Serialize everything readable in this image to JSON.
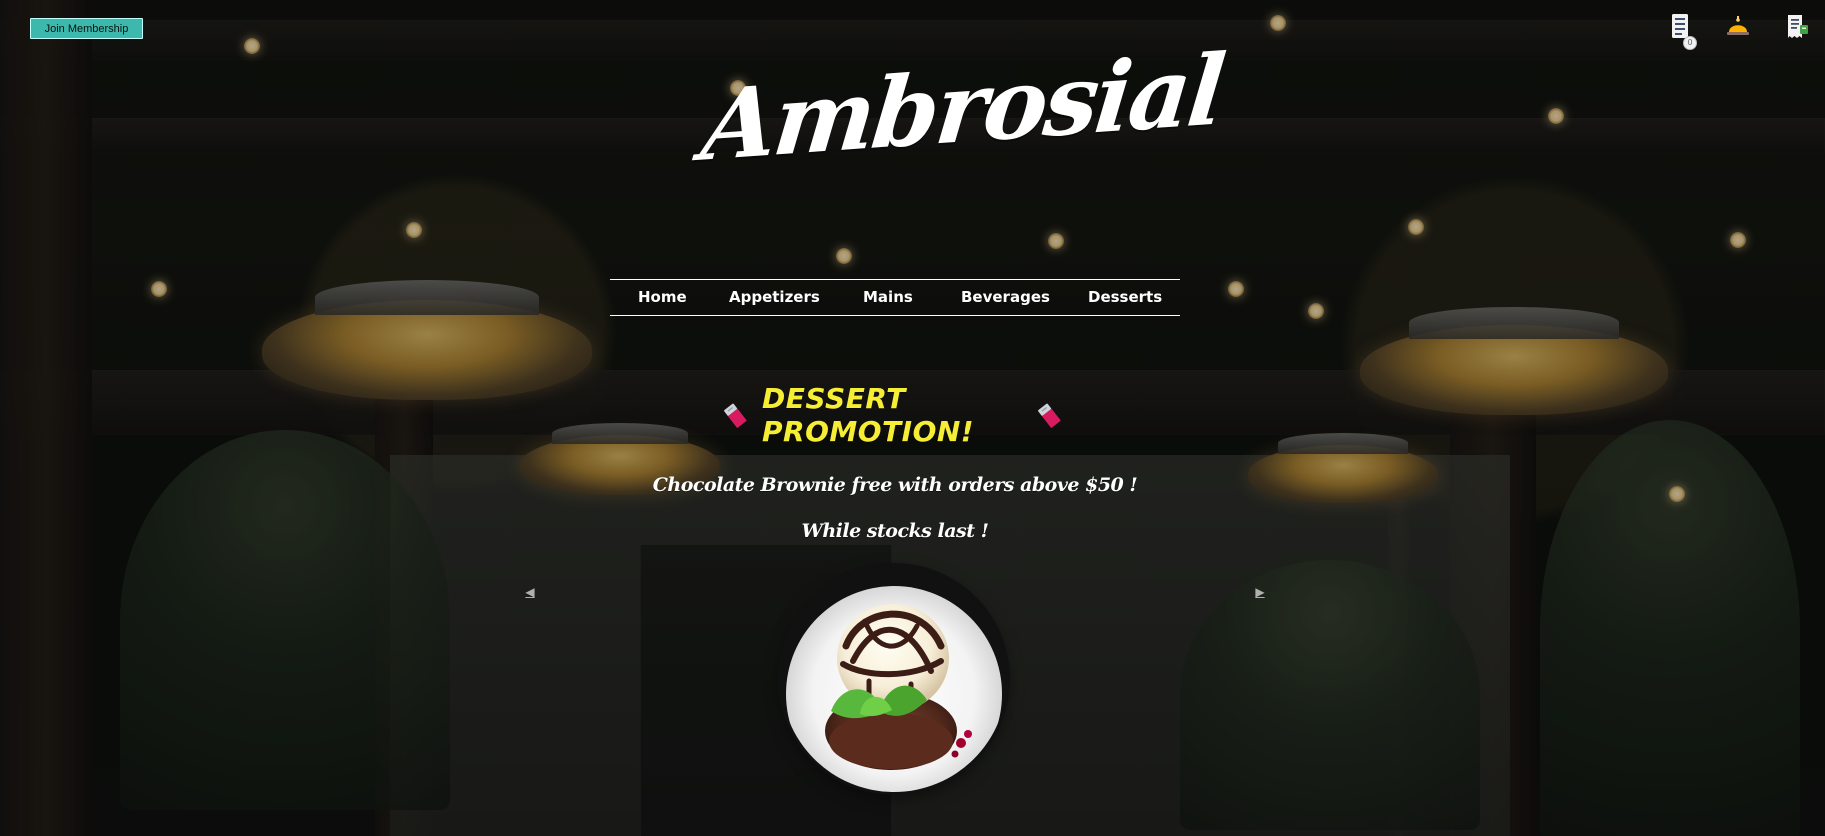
{
  "header": {
    "join_button": "Join Membership",
    "cart_badge": "0"
  },
  "brand": {
    "name": "Ambrosial"
  },
  "nav": {
    "items": [
      {
        "label": "Home"
      },
      {
        "label": "Appetizers"
      },
      {
        "label": "Mains"
      },
      {
        "label": "Beverages"
      },
      {
        "label": "Desserts"
      }
    ]
  },
  "promotion": {
    "title": "DESSERT PROMOTION!",
    "line1": "Chocolate Brownie free with orders above $50 !",
    "line2": "While stocks last !"
  },
  "carousel": {
    "prev": "◀",
    "next": "▶"
  },
  "colors": {
    "accent": "#3db8ad",
    "promo_title": "#f5ee35",
    "text": "#ffffff"
  },
  "icons": {
    "left": "menu-list-icon",
    "middle": "service-bell-icon",
    "right": "receipt-icon",
    "promo": "chocolate-bar-icon",
    "hero": "dessert-image"
  }
}
